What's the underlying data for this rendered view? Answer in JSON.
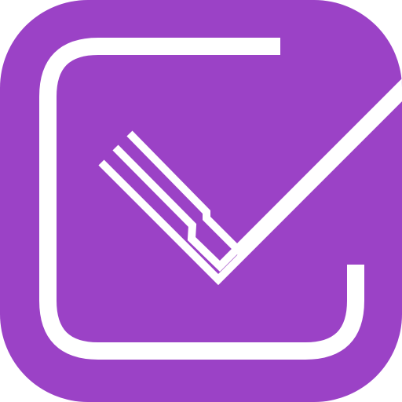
{
  "icon": {
    "name": "checklist-app-icon",
    "semantic": "stylized-checkmark-in-rounded-box",
    "colors": {
      "background": "#9B42C6",
      "foreground": "#FFFFFF"
    }
  }
}
